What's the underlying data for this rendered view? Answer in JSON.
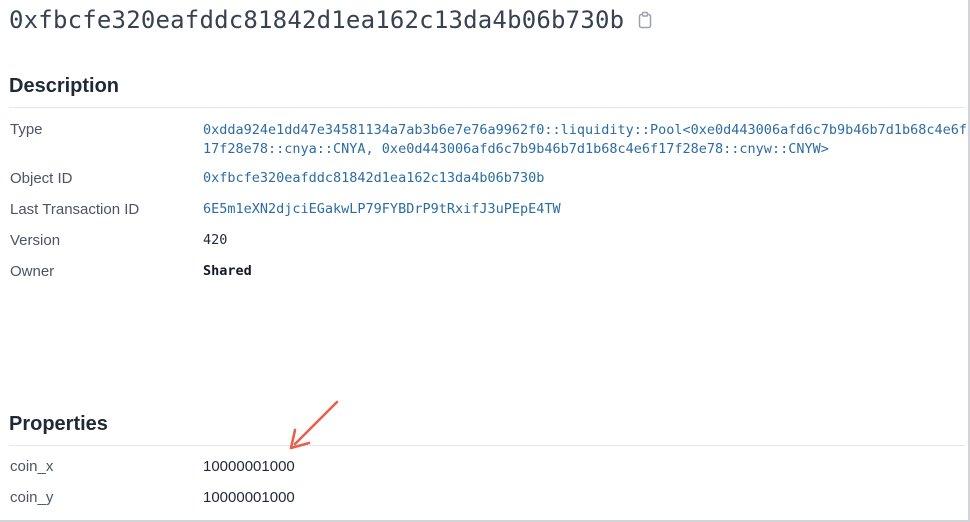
{
  "object": {
    "id_title": "0xfbcfe320eafddc81842d1ea162c13da4b06b730b",
    "copy_icon": "clipboard-icon"
  },
  "description": {
    "heading": "Description",
    "rows": [
      {
        "label": "Type",
        "value": "0xdda924e1dd47e34581134a7ab3b6e7e76a9962f0::liquidity::Pool<0xe0d443006afd6c7b9b46b7d1b68c4e6f17f28e78::cnya::CNYA, 0xe0d443006afd6c7b9b46b7d1b68c4e6f17f28e78::cnyw::CNYW>"
      },
      {
        "label": "Object ID",
        "value": "0xfbcfe320eafddc81842d1ea162c13da4b06b730b"
      },
      {
        "label": "Last Transaction ID",
        "value": "6E5m1eXN2djciEGakwLP79FYBDrP9tRxifJ3uPEpE4TW"
      },
      {
        "label": "Version",
        "value": "420"
      },
      {
        "label": "Owner",
        "value": "Shared"
      }
    ]
  },
  "properties": {
    "heading": "Properties",
    "rows": [
      {
        "label": "coin_x",
        "value": "10000001000"
      },
      {
        "label": "coin_y",
        "value": "10000001000"
      }
    ]
  },
  "annotation": {
    "arrow_color": "#e8604c",
    "arrow_icon": "annotation-arrow-icon"
  },
  "colors": {
    "link": "#2b6ca3",
    "label": "#4b5563",
    "divider": "#e5e7eb"
  }
}
